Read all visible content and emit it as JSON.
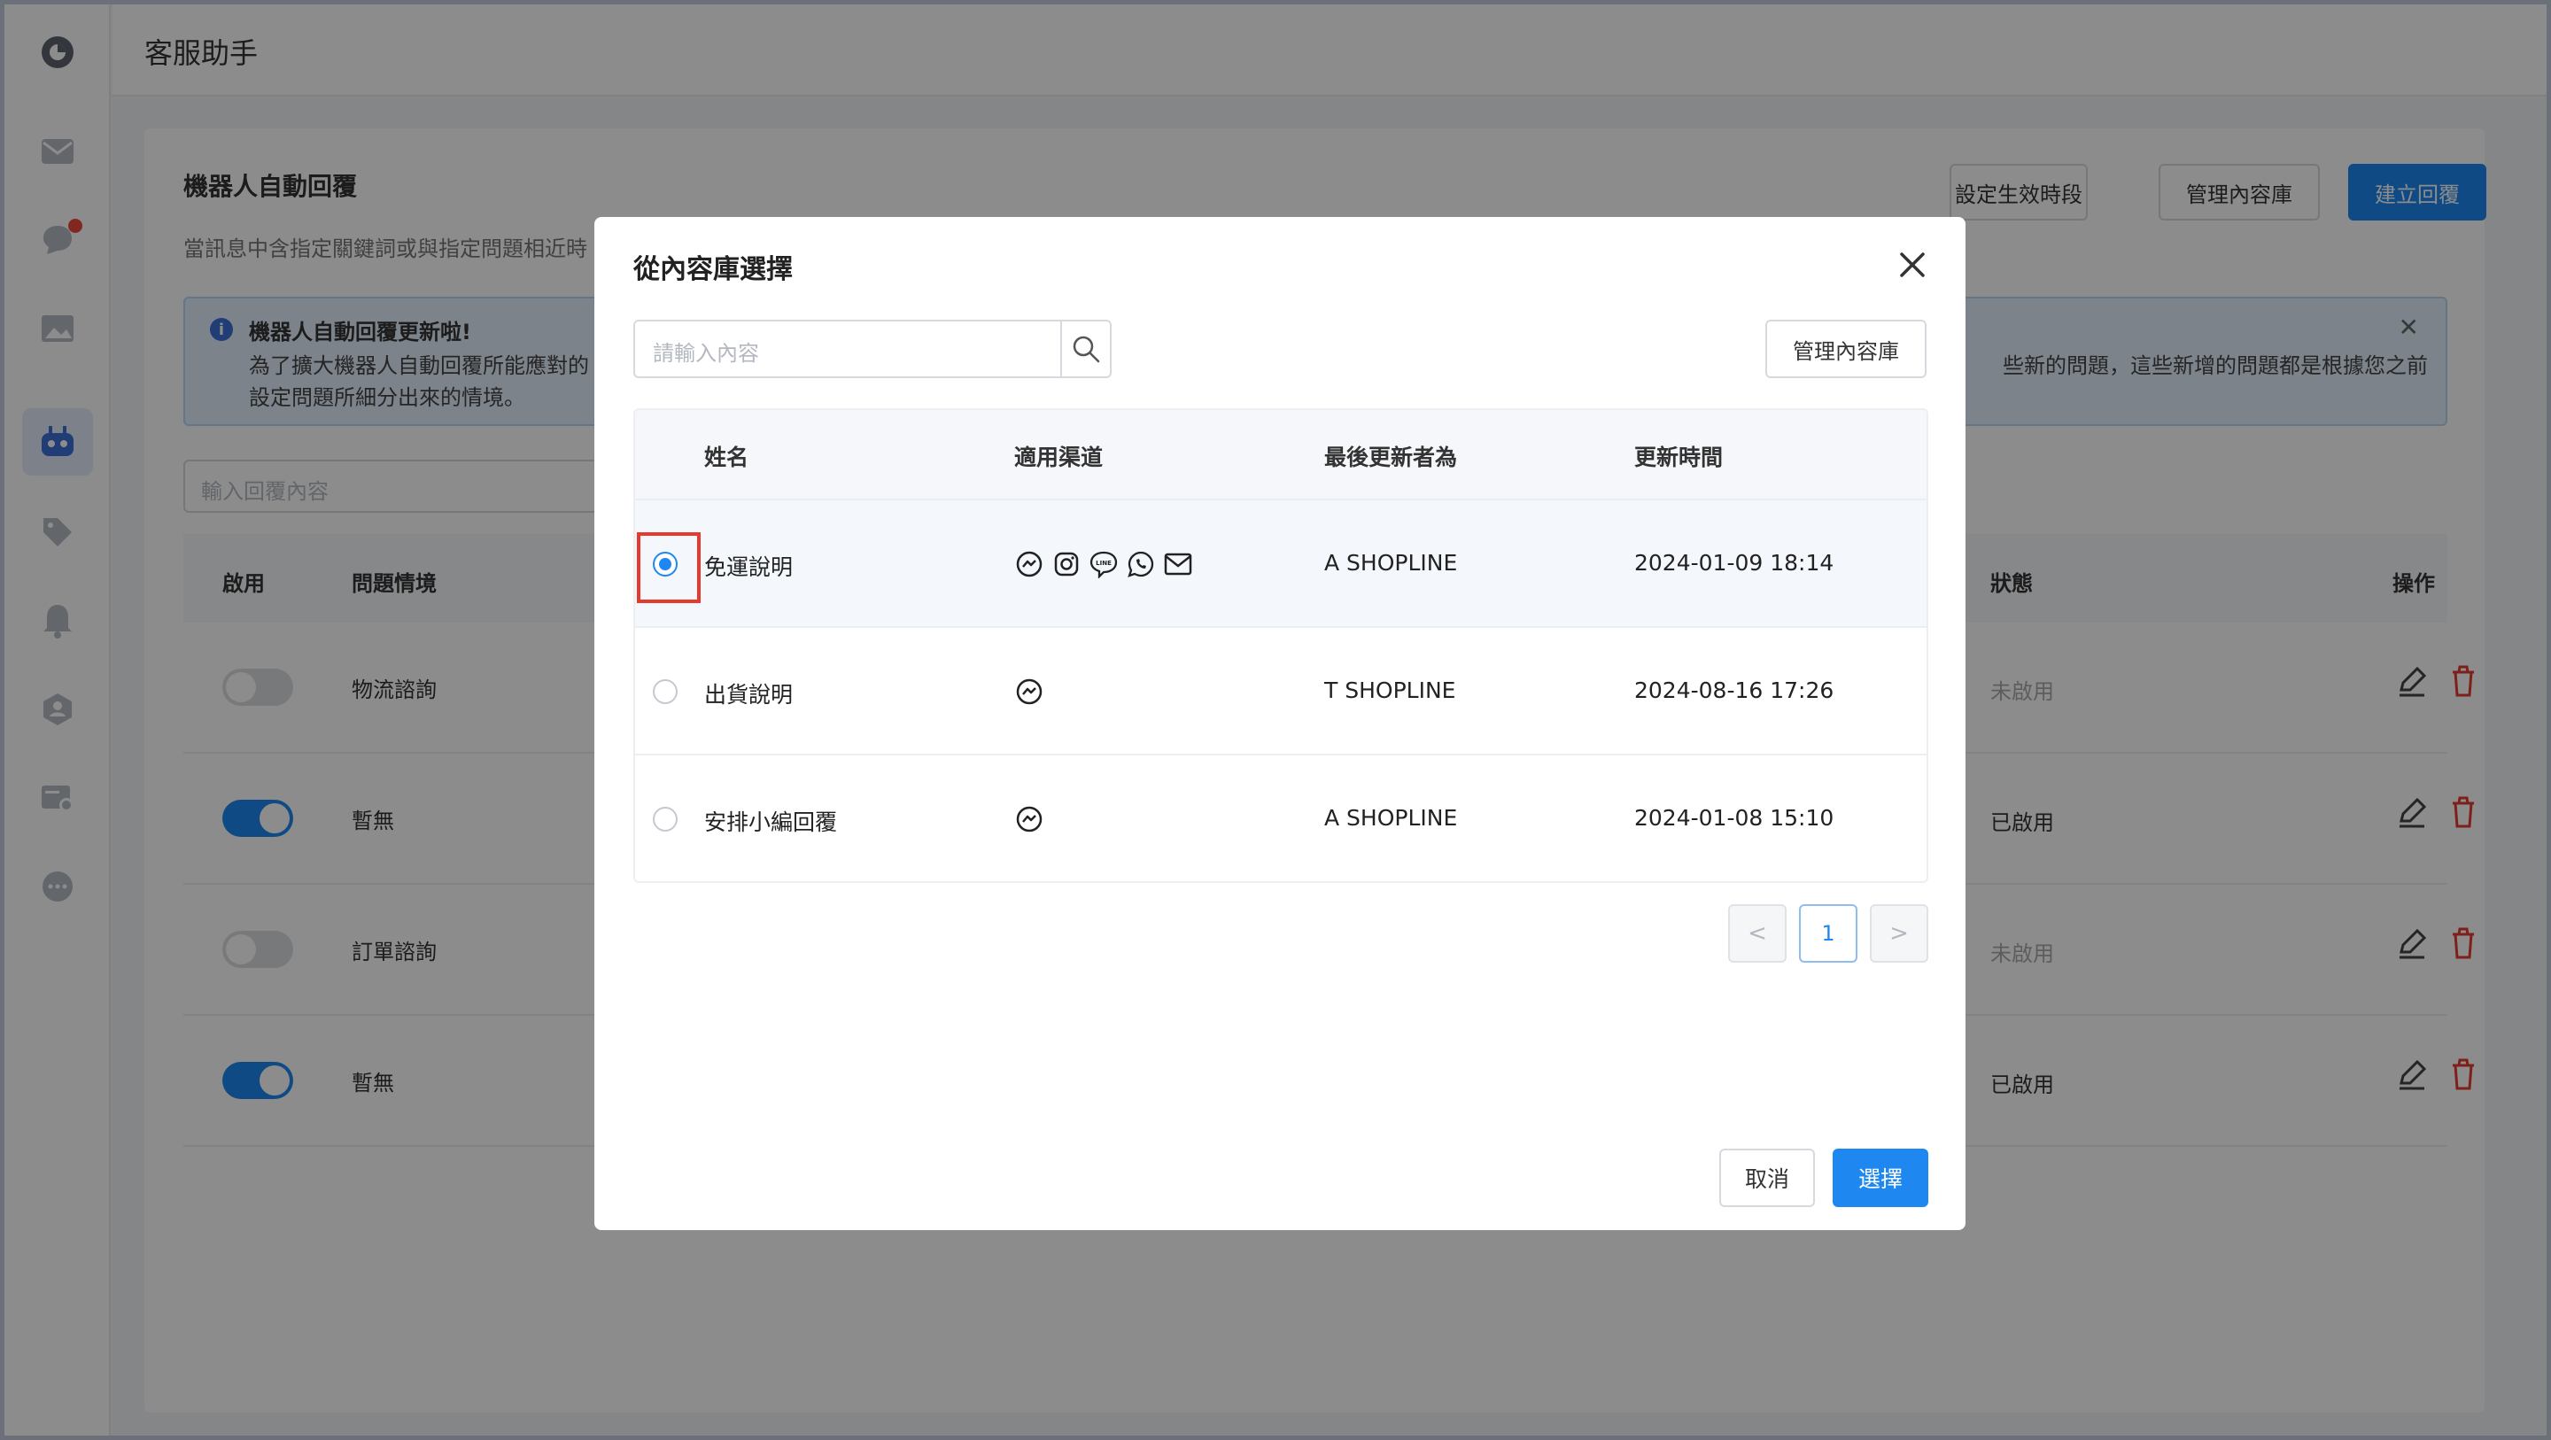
{
  "app": {
    "title": "客服助手"
  },
  "page": {
    "title": "機器人自動回覆",
    "subtitle": "當訊息中含指定關鍵詞或與指定問題相近時",
    "buttons": {
      "schedule": "設定生效時段",
      "manage_library": "管理內容庫",
      "create_reply": "建立回覆"
    },
    "banner": {
      "title": "機器人自動回覆更新啦!",
      "line1": "為了擴大機器人自動回覆所能應對的",
      "line1_right": "些新的問題，這些新增的問題都是根據您之前",
      "line2": "設定問題所細分出來的情境。"
    },
    "search_placeholder": "輸入回覆內容",
    "table_headers": {
      "enable": "啟用",
      "question": "問題情境",
      "status": "狀態",
      "actions": "操作"
    },
    "rows": [
      {
        "enabled": false,
        "question": "物流諮詢",
        "status": "未啟用"
      },
      {
        "enabled": true,
        "question": "暫無",
        "status": "已啟用"
      },
      {
        "enabled": false,
        "question": "訂單諮詢",
        "status": "未啟用"
      },
      {
        "enabled": true,
        "question": "暫無",
        "status": "已啟用"
      }
    ]
  },
  "modal": {
    "title": "從內容庫選擇",
    "search_placeholder": "請輸入內容",
    "manage_button": "管理內容庫",
    "headers": {
      "name": "姓名",
      "channels": "適用渠道",
      "updated_by": "最後更新者為",
      "updated_at": "更新時間"
    },
    "rows": [
      {
        "name": "免運說明",
        "channels": [
          "messenger-icon",
          "instagram-icon",
          "line-icon",
          "whatsapp-icon",
          "email-icon"
        ],
        "updated_by": "A SHOPLINE",
        "updated_at": "2024-01-09 18:14",
        "selected": true
      },
      {
        "name": "出貨說明",
        "channels": [
          "messenger-icon"
        ],
        "updated_by": "T SHOPLINE",
        "updated_at": "2024-08-16 17:26",
        "selected": false
      },
      {
        "name": "安排小編回覆",
        "channels": [
          "messenger-icon"
        ],
        "updated_by": "A SHOPLINE",
        "updated_at": "2024-01-08 15:10",
        "selected": false
      }
    ],
    "pagination": {
      "current_page": "1",
      "prev": "<",
      "next": ">"
    },
    "cancel_label": "取消",
    "select_label": "選擇"
  },
  "colors": {
    "primary": "#1e88f0",
    "highlight": "#e53a2e",
    "overlay": "rgba(0,0,0,0.45)"
  }
}
